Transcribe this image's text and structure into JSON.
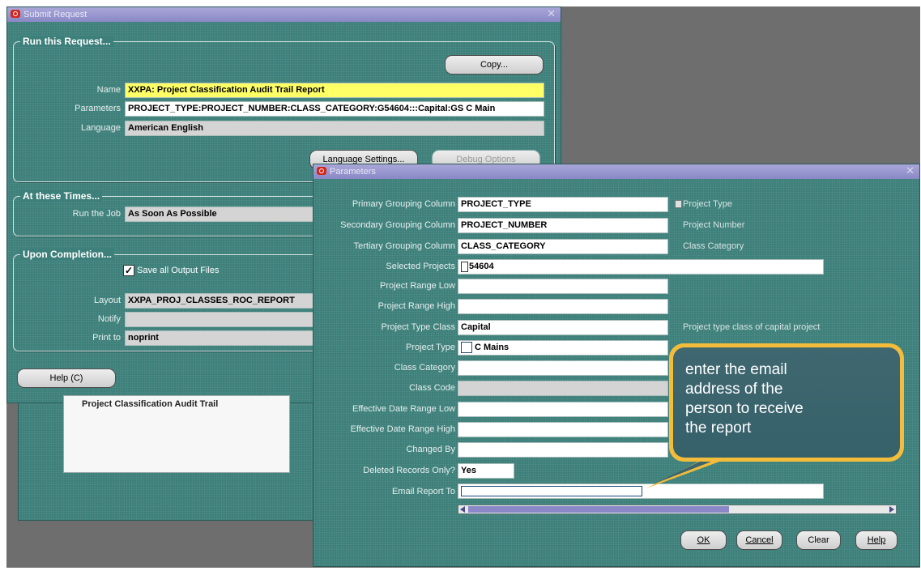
{
  "submit_window": {
    "title": "Submit Request",
    "run_group": {
      "title": "Run this Request...",
      "copy_button": "Copy...",
      "name_label": "Name",
      "name_value": "XXPA: Project Classification Audit Trail Report",
      "parameters_label": "Parameters",
      "parameters_value": "PROJECT_TYPE:PROJECT_NUMBER:CLASS_CATEGORY:G54604:::Capital:GS C Main",
      "language_label": "Language",
      "language_value": "American English",
      "language_settings_button": "Language Settings...",
      "debug_options_button": "Debug Options"
    },
    "times_group": {
      "title": "At these Times...",
      "run_job_label": "Run the Job",
      "run_job_value": "As Soon As Possible"
    },
    "completion_group": {
      "title": "Upon Completion...",
      "save_output_label": "Save all Output Files",
      "save_output_checked": true,
      "layout_label": "Layout",
      "layout_value": "XXPA_PROJ_CLASSES_ROC_REPORT",
      "notify_label": "Notify",
      "notify_value": "",
      "print_to_label": "Print to",
      "print_to_value": "noprint"
    },
    "help_button": "Help (C)",
    "background_text": "Project Classification Audit Trail"
  },
  "parameters_window": {
    "title": "Parameters",
    "fields": {
      "primary_grouping": {
        "label": "Primary Grouping Column",
        "value": "PROJECT_TYPE",
        "hint": "Project Type"
      },
      "secondary_grouping": {
        "label": "Secondary Grouping Column",
        "value": "PROJECT_NUMBER",
        "hint": "Project Number"
      },
      "tertiary_grouping": {
        "label": "Tertiary Grouping Column",
        "value": "CLASS_CATEGORY",
        "hint": "Class Category"
      },
      "selected_projects": {
        "label": "Selected Projects",
        "value": "54604"
      },
      "project_range_low": {
        "label": "Project Range Low",
        "value": ""
      },
      "project_range_high": {
        "label": "Project Range High",
        "value": ""
      },
      "project_type_class": {
        "label": "Project Type Class",
        "value": "Capital",
        "hint": "Project type class of capital project"
      },
      "project_type": {
        "label": "Project Type",
        "value": "C Mains"
      },
      "class_category": {
        "label": "Class Category",
        "value": ""
      },
      "class_code": {
        "label": "Class Code",
        "value": ""
      },
      "effective_date_low": {
        "label": "Effective Date Range Low",
        "value": ""
      },
      "effective_date_high": {
        "label": "Effective Date Range High",
        "value": ""
      },
      "changed_by": {
        "label": "Changed By",
        "value": ""
      },
      "deleted_records_only": {
        "label": "Deleted Records Only?",
        "value": "Yes"
      },
      "email_report_to": {
        "label": "Email Report To",
        "value": ""
      }
    },
    "buttons": {
      "ok": "OK",
      "cancel": "Cancel",
      "clear": "Clear",
      "help": "Help"
    }
  },
  "callout": {
    "text": "enter the email\naddress of the\nperson to receive\nthe report",
    "color": "#f3bc3a"
  },
  "colors": {
    "form_bg": "#3d7f7a",
    "titlebar": "#8a88c6",
    "required_field": "#ffff66",
    "desktop": "#6e6e6e"
  }
}
